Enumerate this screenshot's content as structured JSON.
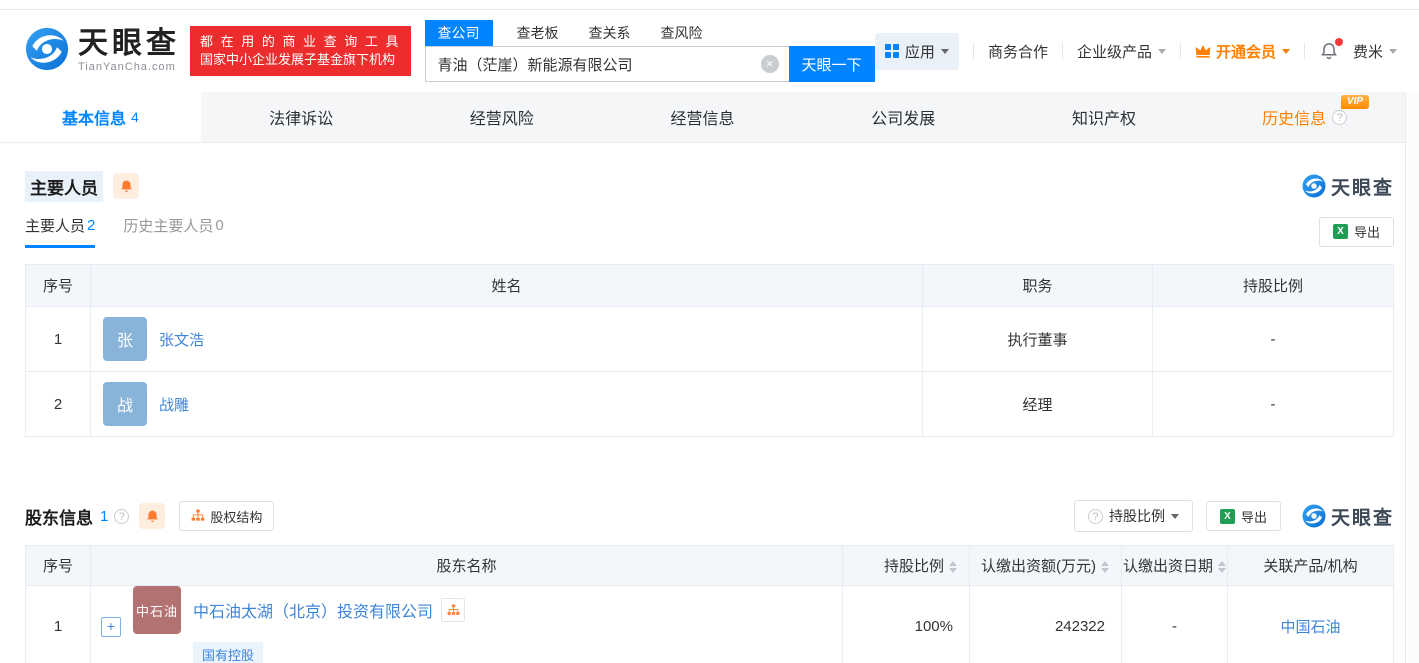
{
  "header": {
    "logo": {
      "title": "天眼查",
      "domain": "TianYanCha.com"
    },
    "slogan": {
      "line1": "都 在 用 的 商 业 查 询 工 具",
      "line2": "国家中小企业发展子基金旗下机构"
    },
    "search": {
      "tabs": [
        "查公司",
        "查老板",
        "查关系",
        "查风险"
      ],
      "active_tab": "查公司",
      "value": "青油（茫崖）新能源有限公司",
      "button": "天眼一下"
    },
    "nav": {
      "apps": "应用",
      "cooperation": "商务合作",
      "enterprise": "企业级产品",
      "vip": "开通会员",
      "user": "费米"
    }
  },
  "tabs": [
    {
      "label": "基本信息",
      "count": "4",
      "active": true
    },
    {
      "label": "法律诉讼"
    },
    {
      "label": "经营风险"
    },
    {
      "label": "经营信息"
    },
    {
      "label": "公司发展"
    },
    {
      "label": "知识产权"
    },
    {
      "label": "历史信息",
      "badge": "VIP"
    }
  ],
  "watermark": "天眼查",
  "people": {
    "title": "主要人员",
    "tabs": [
      {
        "label": "主要人员",
        "count": "2",
        "active": true
      },
      {
        "label": "历史主要人员",
        "count": "0",
        "active": false
      }
    ],
    "export_label": "导出",
    "columns": [
      "序号",
      "姓名",
      "职务",
      "持股比例"
    ],
    "rows": [
      {
        "index": "1",
        "avatar": "张",
        "name": "张文浩",
        "position": "执行董事",
        "ratio": "-"
      },
      {
        "index": "2",
        "avatar": "战",
        "name": "战雕",
        "position": "经理",
        "ratio": "-"
      }
    ]
  },
  "shareholders": {
    "title": "股东信息",
    "count": "1",
    "equity_button": "股权结构",
    "ratio_button": "持股比例",
    "export_label": "导出",
    "columns": [
      {
        "label": "序号",
        "sortable": false
      },
      {
        "label": "股东名称",
        "sortable": false
      },
      {
        "label": "持股比例",
        "sortable": true
      },
      {
        "label": "认缴出资额(万元)",
        "sortable": true
      },
      {
        "label": "认缴出资日期",
        "sortable": true
      },
      {
        "label": "关联产品/机构",
        "sortable": false
      }
    ],
    "rows": [
      {
        "index": "1",
        "avatar": "中石油",
        "name": "中石油太湖（北京）投资有限公司",
        "tag": "国有控股",
        "ratio": "100%",
        "amount": "242322",
        "date": "-",
        "related": "中国石油"
      }
    ]
  },
  "colors": {
    "primary_blue": "#0084ff",
    "link_blue": "#3e86d8",
    "slogan_red": "#ed2d2d",
    "vip_orange": "#ff8000",
    "bell_orange": "#ff7b2f",
    "avatar_blue": "#89b4d9",
    "avatar_maroon": "#b27272",
    "table_header_bg": "#f3f7fb"
  }
}
